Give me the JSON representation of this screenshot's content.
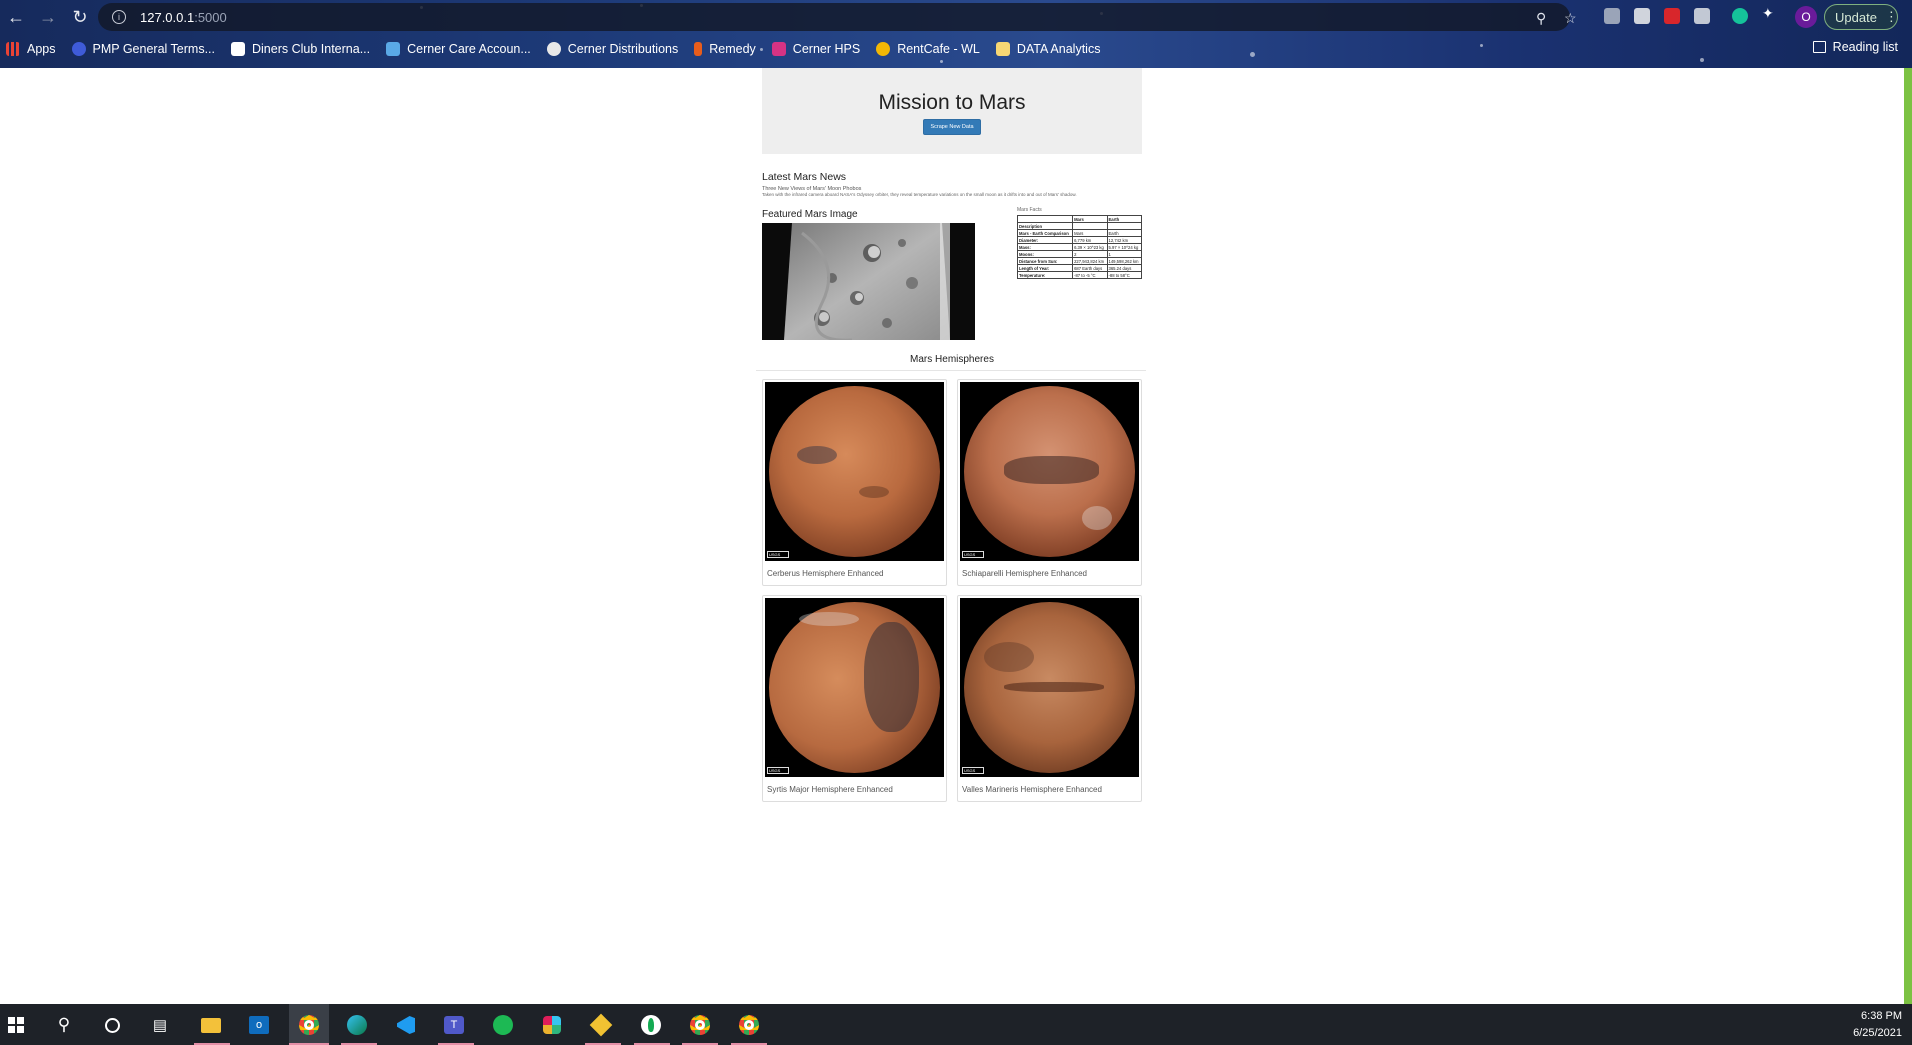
{
  "browser": {
    "url_host": "127.0.0.1",
    "url_port": ":5000",
    "update_label": "Update",
    "profile_initial": "O",
    "bookmarks": [
      {
        "label": "Apps",
        "icon": "apps-grid-icon"
      },
      {
        "label": "PMP General Terms...",
        "icon": "pmp-icon"
      },
      {
        "label": "Diners Club Interna...",
        "icon": "diners-club-icon"
      },
      {
        "label": "Cerner Care Accoun...",
        "icon": "cerner-care-icon"
      },
      {
        "label": "Cerner Distributions",
        "icon": "globe-icon"
      },
      {
        "label": "Remedy",
        "icon": "remedy-icon"
      },
      {
        "label": "Cerner HPS",
        "icon": "cerner-hps-icon"
      },
      {
        "label": "RentCafe - WL",
        "icon": "rentcafe-icon"
      },
      {
        "label": "DATA Analytics",
        "icon": "folder-icon"
      }
    ],
    "reading_list_label": "Reading list"
  },
  "page": {
    "title": "Mission to Mars",
    "scrape_button": "Scrape New Data",
    "news": {
      "section_title": "Latest Mars News",
      "headline": "Three New Views of Mars' Moon Phobos",
      "paragraph": "Taken with the infrared camera aboard NASA's Odyssey orbiter, they reveal temperature variations on the small moon as it drifts into and out of Mars' shadow."
    },
    "featured": {
      "section_title": "Featured Mars Image"
    },
    "facts": {
      "caption": "Mars Facts",
      "header": [
        "",
        "Mars",
        "Earth"
      ],
      "rows": [
        [
          "Description",
          "",
          ""
        ],
        [
          "Mars - Earth Comparison",
          "Mars",
          "Earth"
        ],
        [
          "Diameter:",
          "6,779 km",
          "12,742 km"
        ],
        [
          "Mass:",
          "6.39 × 10^23 kg",
          "5.97 × 10^24 kg"
        ],
        [
          "Moons:",
          "2",
          "1"
        ],
        [
          "Distance from Sun:",
          "227,943,824 km",
          "149,598,262 km"
        ],
        [
          "Length of Year:",
          "687 Earth days",
          "365.24 days"
        ],
        [
          "Temperature:",
          "-87 to -5 °C",
          "-88 to 58°C"
        ]
      ]
    },
    "hemispheres": {
      "section_title": "Mars Hemispheres",
      "items": [
        {
          "title": "Cerberus Hemisphere Enhanced"
        },
        {
          "title": "Schiaparelli Hemisphere Enhanced"
        },
        {
          "title": "Syrtis Major Hemisphere Enhanced"
        },
        {
          "title": "Valles Marineris Hemisphere Enhanced"
        }
      ]
    }
  },
  "taskbar": {
    "time": "6:38 PM",
    "date": "6/25/2021",
    "apps": [
      "windows-start-icon",
      "search-icon",
      "cortana-icon",
      "task-view-icon",
      "file-explorer-icon",
      "outlook-icon",
      "chrome-icon",
      "edge-icon",
      "vscode-icon",
      "teams-icon",
      "spotify-icon",
      "slack-icon",
      "git-icon",
      "mongodb-icon",
      "chrome-icon",
      "chrome-icon"
    ]
  },
  "colors": {
    "accent_button": "#337ab7",
    "jumbotron_bg": "#eeeeee",
    "mars_orange": "#c8703f"
  }
}
